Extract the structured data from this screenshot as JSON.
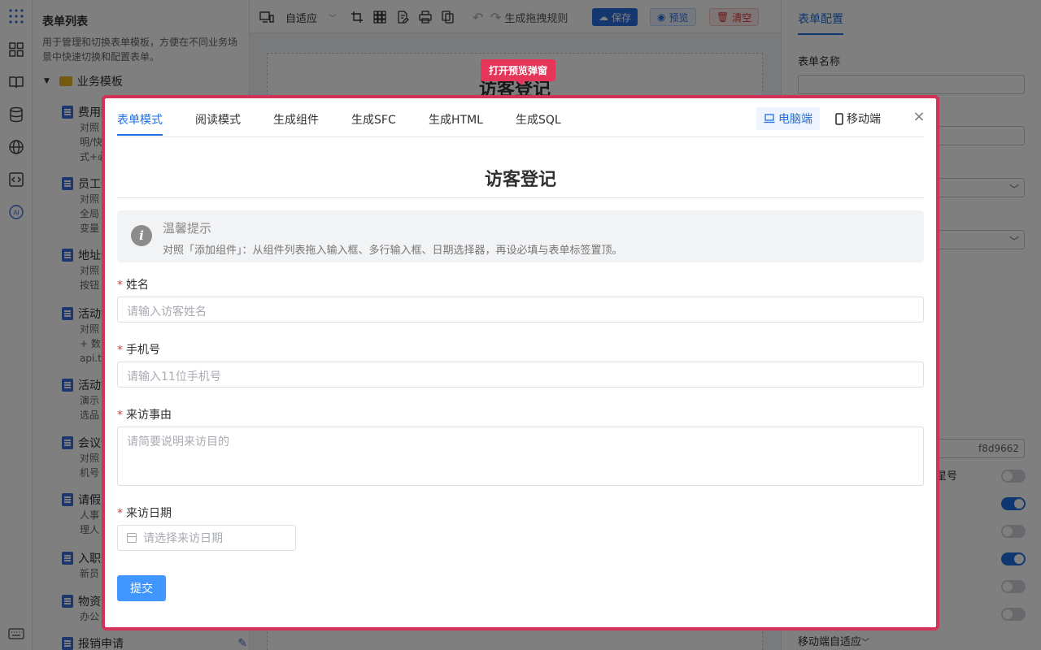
{
  "left_panel": {
    "title": "表单列表",
    "description": "用于管理和切换表单模板，方便在不同业务场景中快速切换和配置表单。",
    "group": "业务模板",
    "templates": [
      {
        "name": "费用报销",
        "desc": "对照\n明/快\n式+必"
      },
      {
        "name": "员工信息",
        "desc": "对照\n全局\n变量"
      },
      {
        "name": "地址信息",
        "desc": "对照\n按钮"
      },
      {
        "name": "活动报名",
        "desc": "对照\n+ 数\napi.t"
      },
      {
        "name": "活动报名",
        "desc": "演示\n选品"
      },
      {
        "name": "会议预定",
        "desc": "对照\n机号"
      },
      {
        "name": "请假申请",
        "desc": "人事\n理人"
      },
      {
        "name": "入职登记",
        "desc": "新员"
      },
      {
        "name": "物资申领",
        "desc": "办公"
      },
      {
        "name": "报销申请",
        "desc": ""
      }
    ]
  },
  "toolbar": {
    "adaptive": "自适应",
    "rule": "生成拖拽规则",
    "save": "保存",
    "preview": "预览",
    "clear": "清空"
  },
  "canvas": {
    "title": "访客登记"
  },
  "right_panel": {
    "title": "表单配置",
    "form_name_label": "表单名称",
    "id_value": "f8d9662",
    "partial_label": "星号",
    "mobile_label": "移动端自适应"
  },
  "tooltip": "打开预览弹窗",
  "modal": {
    "tabs": [
      "表单模式",
      "阅读模式",
      "生成组件",
      "生成SFC",
      "生成HTML",
      "生成SQL"
    ],
    "active_tab": 0,
    "device_pc": "电脑端",
    "device_mobile": "移动端",
    "form_title": "访客登记",
    "alert_title": "温馨提示",
    "alert_desc": "对照「添加组件」：从组件列表拖入输入框、多行输入框、日期选择器，再设必填与表单标签置顶。",
    "fields": {
      "name_label": "姓名",
      "name_placeholder": "请输入访客姓名",
      "phone_label": "手机号",
      "phone_placeholder": "请输入11位手机号",
      "reason_label": "来访事由",
      "reason_placeholder": "请简要说明来访目的",
      "date_label": "来访日期",
      "date_placeholder": "请选择来访日期"
    },
    "submit": "提交"
  }
}
